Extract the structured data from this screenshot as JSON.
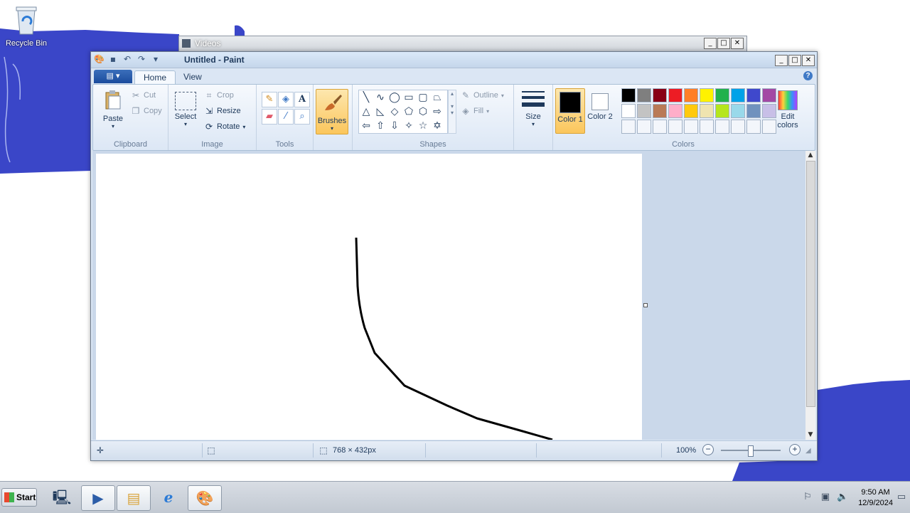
{
  "desktop": {
    "recycle_bin_label": "Recycle Bin"
  },
  "videos_window": {
    "title": "Videos"
  },
  "paint": {
    "title": "Untitled - Paint",
    "tabs": [
      "Home",
      "View"
    ],
    "clipboard": {
      "paste": "Paste",
      "cut": "Cut",
      "copy": "Copy",
      "group": "Clipboard"
    },
    "image": {
      "select": "Select",
      "crop": "Crop",
      "resize": "Resize",
      "rotate": "Rotate",
      "group": "Image"
    },
    "tools": {
      "group": "Tools"
    },
    "brushes": {
      "label": "Brushes"
    },
    "shapes": {
      "outline": "Outline",
      "fill": "Fill",
      "group": "Shapes"
    },
    "size": {
      "label": "Size"
    },
    "colors": {
      "color1": "Color 1",
      "color2": "Color 2",
      "edit": "Edit colors",
      "group": "Colors",
      "color1_value": "#000000",
      "color2_value": "#ffffff",
      "palette": [
        "#000000",
        "#7f7f7f",
        "#880015",
        "#ed1c24",
        "#ff7f27",
        "#fff200",
        "#22b14c",
        "#00a2e8",
        "#3f48cc",
        "#a349a4",
        "#ffffff",
        "#c3c3c3",
        "#b97a57",
        "#ffaec9",
        "#ffc90e",
        "#efe4b0",
        "#b5e61d",
        "#99d9ea",
        "#7092be",
        "#c8bfe7"
      ]
    },
    "status": {
      "canvas_size": "768 × 432px",
      "zoom": "100%",
      "zoom_level": 0.5
    }
  },
  "taskbar": {
    "start": "Start",
    "time": "9:50 AM",
    "date": "12/9/2024",
    "accent": "#3a46c8"
  }
}
